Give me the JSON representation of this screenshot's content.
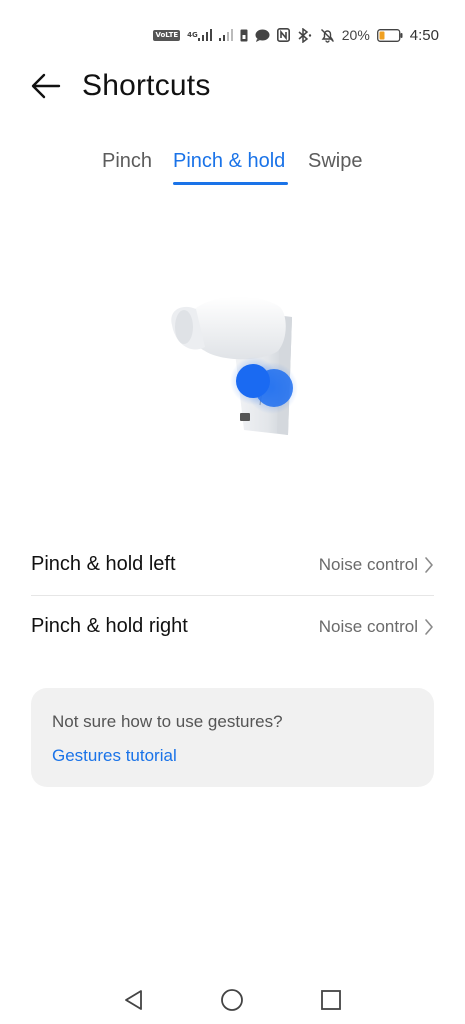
{
  "status_bar": {
    "volte": "VoLTE",
    "network": "4G",
    "battery_percent": "20%",
    "time": "4:50",
    "icons": [
      "volte-icon",
      "signal-icon",
      "signal-icon-2",
      "sim-icon",
      "message-icon",
      "nfc-icon",
      "bluetooth-icon",
      "mute-icon",
      "battery-icon"
    ]
  },
  "header": {
    "title": "Shortcuts",
    "back_icon": "arrow-left-icon"
  },
  "tabs": [
    {
      "label": "Pinch",
      "selected": false
    },
    {
      "label": "Pinch & hold",
      "selected": true
    },
    {
      "label": "Swipe",
      "selected": false
    }
  ],
  "settings": [
    {
      "label": "Pinch & hold left",
      "value": "Noise control"
    },
    {
      "label": "Pinch & hold right",
      "value": "Noise control"
    }
  ],
  "help": {
    "question": "Not sure how to use gestures?",
    "link": "Gestures tutorial"
  },
  "colors": {
    "accent": "#1a73e8",
    "card_background": "#f1f1f1",
    "divider": "#e6e6e6"
  },
  "navbar": {
    "icons": [
      "back-triangle-icon",
      "home-circle-icon",
      "recent-square-icon"
    ]
  }
}
